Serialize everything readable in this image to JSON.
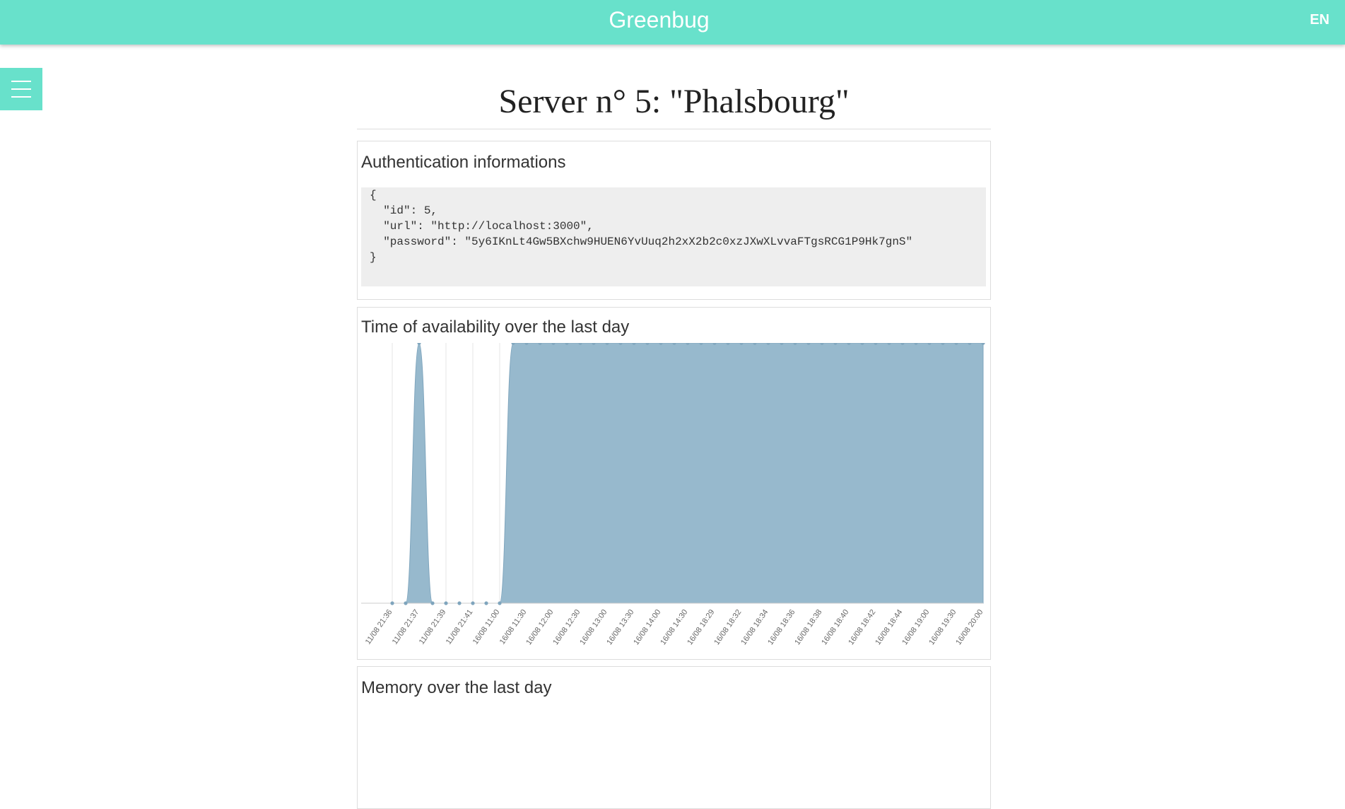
{
  "app": {
    "title": "Greenbug",
    "language": "EN"
  },
  "page": {
    "title": "Server n° 5: \"Phalsbourg\""
  },
  "auth": {
    "heading": "Authentication informations",
    "json": "{\n  \"id\": 5,\n  \"url\": \"http://localhost:3000\",\n  \"password\": \"5y6IKnLt4Gw5BXchw9HUEN6YvUuq2h2xX2b2c0xzJXwXLvvaFTgsRCG1P9Hk7gnS\"\n}"
  },
  "availability": {
    "heading": "Time of availability over the last day"
  },
  "memory": {
    "heading": "Memory over the last day"
  },
  "colors": {
    "accent": "#68e1cb",
    "area_fill": "#97b9cd",
    "area_stroke": "#7fa5bd"
  },
  "icons": {
    "menu": "hamburger-icon"
  },
  "chart_data": {
    "type": "area",
    "title": "",
    "xlabel": "",
    "ylabel": "",
    "x": [
      "11/08 21:36",
      "11/08 21:37",
      "11/08 21:39",
      "11/08 21:41",
      "16/08 11:00",
      "16/08 11:30",
      "16/08 12:00",
      "16/08 12:30",
      "16/08 13:00",
      "16/08 13:30",
      "16/08 14:00",
      "16/08 14:30",
      "16/08 18:29",
      "16/08 18:32",
      "16/08 18:34",
      "16/08 18:36",
      "16/08 18:38",
      "16/08 18:40",
      "16/08 18:42",
      "16/08 18:44",
      "16/08 19:00",
      "16/08 19:30",
      "16/08 20:00"
    ],
    "points": [
      {
        "x": "11/08 21:36",
        "y": 0
      },
      {
        "x": "",
        "y": 0
      },
      {
        "x": "11/08 21:37",
        "y": 1
      },
      {
        "x": "",
        "y": 0
      },
      {
        "x": "11/08 21:39",
        "y": 0
      },
      {
        "x": "",
        "y": 0
      },
      {
        "x": "11/08 21:41",
        "y": 0
      },
      {
        "x": "",
        "y": 0
      },
      {
        "x": "16/08 11:00",
        "y": 0
      },
      {
        "x": "",
        "y": 1
      },
      {
        "x": "16/08 11:30",
        "y": 1
      },
      {
        "x": "",
        "y": 1
      },
      {
        "x": "16/08 12:00",
        "y": 1
      },
      {
        "x": "",
        "y": 1
      },
      {
        "x": "16/08 12:30",
        "y": 1
      },
      {
        "x": "",
        "y": 1
      },
      {
        "x": "16/08 13:00",
        "y": 1
      },
      {
        "x": "",
        "y": 1
      },
      {
        "x": "16/08 13:30",
        "y": 1
      },
      {
        "x": "",
        "y": 1
      },
      {
        "x": "16/08 14:00",
        "y": 1
      },
      {
        "x": "",
        "y": 1
      },
      {
        "x": "16/08 14:30",
        "y": 1
      },
      {
        "x": "",
        "y": 1
      },
      {
        "x": "16/08 18:29",
        "y": 1
      },
      {
        "x": "",
        "y": 1
      },
      {
        "x": "16/08 18:32",
        "y": 1
      },
      {
        "x": "",
        "y": 1
      },
      {
        "x": "16/08 18:34",
        "y": 1
      },
      {
        "x": "",
        "y": 1
      },
      {
        "x": "16/08 18:36",
        "y": 1
      },
      {
        "x": "",
        "y": 1
      },
      {
        "x": "16/08 18:38",
        "y": 1
      },
      {
        "x": "",
        "y": 1
      },
      {
        "x": "16/08 18:40",
        "y": 1
      },
      {
        "x": "",
        "y": 1
      },
      {
        "x": "16/08 18:42",
        "y": 1
      },
      {
        "x": "",
        "y": 1
      },
      {
        "x": "16/08 18:44",
        "y": 1
      },
      {
        "x": "",
        "y": 1
      },
      {
        "x": "16/08 19:00",
        "y": 1
      },
      {
        "x": "",
        "y": 1
      },
      {
        "x": "16/08 19:30",
        "y": 1
      },
      {
        "x": "",
        "y": 1
      },
      {
        "x": "16/08 20:00",
        "y": 1
      }
    ],
    "ylim": [
      0,
      1
    ],
    "grid": true,
    "legend": "none"
  }
}
